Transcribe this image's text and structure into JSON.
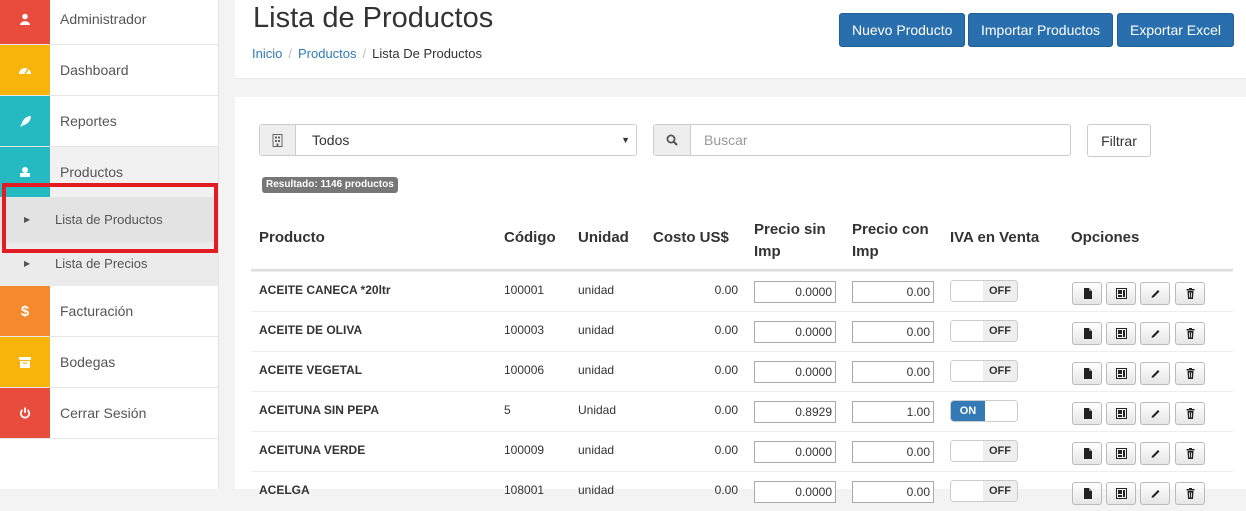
{
  "sidebar": {
    "items": [
      {
        "label": "Administrador",
        "icon": "user-icon",
        "color": "#e84c3d"
      },
      {
        "label": "Dashboard",
        "icon": "dashboard-icon",
        "color": "#f8b40a"
      },
      {
        "label": "Reportes",
        "icon": "rocket-icon",
        "color": "#25b9c1"
      },
      {
        "label": "Productos",
        "icon": "products-icon",
        "color": "#25b9c1"
      },
      {
        "label": "Facturación",
        "icon": "dollar-icon",
        "color": "#f48a2b"
      },
      {
        "label": "Bodegas",
        "icon": "archive-icon",
        "color": "#f8b40a"
      },
      {
        "label": "Cerrar Sesión",
        "icon": "power-icon",
        "color": "#e84c3d"
      }
    ],
    "subitems": [
      {
        "label": "Lista de Productos",
        "active": true
      },
      {
        "label": "Lista de Precios",
        "active": false
      }
    ]
  },
  "header": {
    "title": "Lista de Productos",
    "breadcrumb": [
      "Inicio",
      "Productos",
      "Lista De Productos"
    ],
    "buttons": [
      "Nuevo Producto",
      "Importar Productos",
      "Exportar Excel"
    ]
  },
  "filters": {
    "category_selected": "Todos",
    "search_placeholder": "Buscar",
    "filter_label": "Filtrar",
    "result_text": "Resultado: 1146 productos"
  },
  "table": {
    "headers": {
      "producto": "Producto",
      "codigo": "Código",
      "unidad": "Unidad",
      "costo": "Costo US$",
      "precio_sin": "Precio sin Imp",
      "precio_con": "Precio con Imp",
      "iva": "IVA en Venta",
      "opciones": "Opciones"
    },
    "rows": [
      {
        "producto": "ACEITE CANECA *20ltr",
        "codigo": "100001",
        "unidad": "unidad",
        "costo": "0.00",
        "precio_sin": "0.0000",
        "precio_con": "0.00",
        "iva": "OFF"
      },
      {
        "producto": "ACEITE DE OLIVA",
        "codigo": "100003",
        "unidad": "unidad",
        "costo": "0.00",
        "precio_sin": "0.0000",
        "precio_con": "0.00",
        "iva": "OFF"
      },
      {
        "producto": "ACEITE VEGETAL",
        "codigo": "100006",
        "unidad": "unidad",
        "costo": "0.00",
        "precio_sin": "0.0000",
        "precio_con": "0.00",
        "iva": "OFF"
      },
      {
        "producto": "ACEITUNA SIN PEPA",
        "codigo": "5",
        "unidad": "Unidad",
        "costo": "0.00",
        "precio_sin": "0.8929",
        "precio_con": "1.00",
        "iva": "ON"
      },
      {
        "producto": "ACEITUNA VERDE",
        "codigo": "100009",
        "unidad": "unidad",
        "costo": "0.00",
        "precio_sin": "0.0000",
        "precio_con": "0.00",
        "iva": "OFF"
      },
      {
        "producto": "ACELGA",
        "codigo": "108001",
        "unidad": "unidad",
        "costo": "0.00",
        "precio_sin": "0.0000",
        "precio_con": "0.00",
        "iva": "OFF"
      }
    ]
  },
  "colors": {
    "primary_button": "#2a6fad",
    "link": "#337ab7",
    "highlight_box": "#e31b23"
  }
}
